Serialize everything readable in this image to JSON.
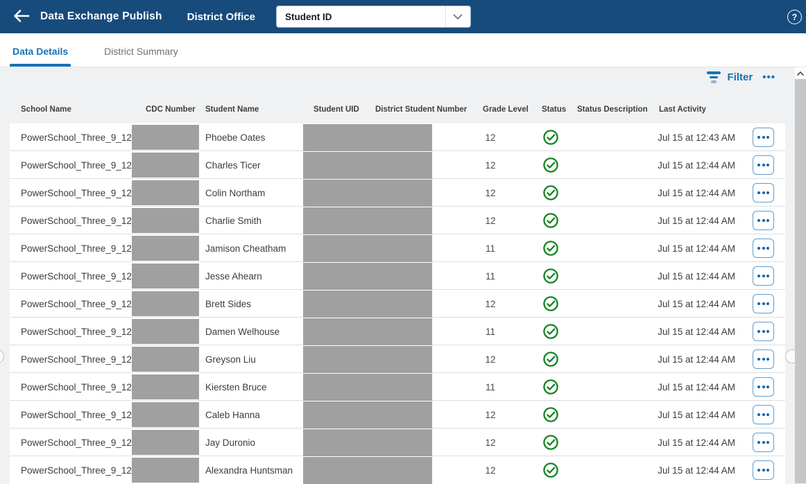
{
  "header": {
    "title": "Data Exchange Publish",
    "context": "District Office",
    "dropdown_value": "Student ID",
    "help_label": "?"
  },
  "tabs": [
    {
      "label": "Data Details",
      "active": true
    },
    {
      "label": "District Summary",
      "active": false
    }
  ],
  "toolbar": {
    "filter_label": "Filter",
    "more_label": "•••"
  },
  "table": {
    "columns": [
      "School Name",
      "CDC Number",
      "Student Name",
      "Student UID",
      "District Student Number",
      "Grade Level",
      "Status",
      "Status Description",
      "Last Activity"
    ],
    "rows": [
      {
        "school": "PowerSchool_Three_9_12",
        "cdc_number": "[redacted]",
        "student": "Phoebe Oates",
        "student_uid": "[redacted]",
        "grade": "12",
        "status": "success",
        "status_description": "",
        "last_activity": "Jul 15 at 12:43 AM"
      },
      {
        "school": "PowerSchool_Three_9_12",
        "cdc_number": "[redacted]",
        "student": "Charles Ticer",
        "student_uid": "[redacted]",
        "grade": "12",
        "status": "success",
        "status_description": "",
        "last_activity": "Jul 15 at 12:44 AM"
      },
      {
        "school": "PowerSchool_Three_9_12",
        "cdc_number": "[redacted]",
        "student": "Colin Northam",
        "student_uid": "[redacted]",
        "grade": "12",
        "status": "success",
        "status_description": "",
        "last_activity": "Jul 15 at 12:44 AM"
      },
      {
        "school": "PowerSchool_Three_9_12",
        "cdc_number": "[redacted]",
        "student": "Charlie Smith",
        "student_uid": "[redacted]",
        "grade": "12",
        "status": "success",
        "status_description": "",
        "last_activity": "Jul 15 at 12:44 AM"
      },
      {
        "school": "PowerSchool_Three_9_12",
        "cdc_number": "[redacted]",
        "student": "Jamison Cheatham",
        "student_uid": "[redacted]",
        "grade": "11",
        "status": "success",
        "status_description": "",
        "last_activity": "Jul 15 at 12:44 AM"
      },
      {
        "school": "PowerSchool_Three_9_12",
        "cdc_number": "[redacted]",
        "student": "Jesse Ahearn",
        "student_uid": "[redacted]",
        "grade": "11",
        "status": "success",
        "status_description": "",
        "last_activity": "Jul 15 at 12:44 AM"
      },
      {
        "school": "PowerSchool_Three_9_12",
        "cdc_number": "[redacted]",
        "student": "Brett Sides",
        "student_uid": "[redacted]",
        "grade": "12",
        "status": "success",
        "status_description": "",
        "last_activity": "Jul 15 at 12:44 AM"
      },
      {
        "school": "PowerSchool_Three_9_12",
        "cdc_number": "[redacted]",
        "student": "Damen Welhouse",
        "student_uid": "[redacted]",
        "grade": "11",
        "status": "success",
        "status_description": "",
        "last_activity": "Jul 15 at 12:44 AM"
      },
      {
        "school": "PowerSchool_Three_9_12",
        "cdc_number": "[redacted]",
        "student": "Greyson Liu",
        "student_uid": "[redacted]",
        "grade": "12",
        "status": "success",
        "status_description": "",
        "last_activity": "Jul 15 at 12:44 AM"
      },
      {
        "school": "PowerSchool_Three_9_12",
        "cdc_number": "[redacted]",
        "student": "Kiersten Bruce",
        "student_uid": "[redacted]",
        "grade": "11",
        "status": "success",
        "status_description": "",
        "last_activity": "Jul 15 at 12:44 AM"
      },
      {
        "school": "PowerSchool_Three_9_12",
        "cdc_number": "[redacted]",
        "student": "Caleb Hanna",
        "student_uid": "[redacted]",
        "grade": "12",
        "status": "success",
        "status_description": "",
        "last_activity": "Jul 15 at 12:44 AM"
      },
      {
        "school": "PowerSchool_Three_9_12",
        "cdc_number": "[redacted]",
        "student": "Jay Duronio",
        "student_uid": "[redacted]",
        "grade": "12",
        "status": "success",
        "status_description": "",
        "last_activity": "Jul 15 at 12:44 AM"
      },
      {
        "school": "PowerSchool_Three_9_12",
        "cdc_number": "[redacted]",
        "student": "Alexandra Huntsman",
        "student_uid": "[redacted]",
        "grade": "12",
        "status": "success",
        "status_description": "",
        "last_activity": "Jul 15 at 12:44 AM"
      }
    ]
  },
  "colors": {
    "header_bg": "#174B7C",
    "accent_blue": "#1272B6",
    "status_green": "#138321",
    "redaction_gray": "#A0A0A0",
    "page_bg": "#F0F1F2"
  }
}
